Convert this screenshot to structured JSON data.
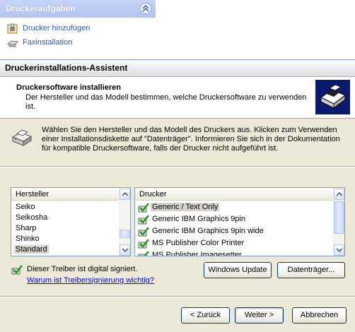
{
  "task_pane": {
    "title": "Druckeraufgaben",
    "items": [
      {
        "label": "Drucker hinzufügen",
        "icon": "add-printer-icon"
      },
      {
        "label": "Faxinstallation",
        "icon": "fax-icon"
      }
    ]
  },
  "dialog": {
    "title": "Druckerinstallations-Assistent",
    "header": {
      "title": "Druckersoftware installieren",
      "subtitle": "Der Hersteller und das Modell bestimmen, welche Druckersoftware zu verwenden ist."
    },
    "instructions": "Wählen Sie den Hersteller und das Modell des Druckers aus. Klicken zum Verwenden einer Installationsdiskette auf \"Datenträger\". Informieren Sie sich in der Dokumentation für kompatible Druckersoftware, falls der Drucker nicht aufgeführt ist.",
    "manufacturer_list": {
      "header": "Hersteller",
      "items": [
        "Seiko",
        "Seikosha",
        "Sharp",
        "Shinko",
        "Standard"
      ],
      "selected": "Standard"
    },
    "printer_list": {
      "header": "Drucker",
      "items": [
        "Generic / Text Only",
        "Generic IBM Graphics 9pin",
        "Generic IBM Graphics 9pin wide",
        "MS Publisher Color Printer",
        "MS Publisher Imagesetter"
      ],
      "selected": "Generic / Text Only"
    },
    "signature": {
      "text": "Dieser Treiber ist digital signiert.",
      "link": "Warum ist Treibersignierung wichtig?"
    },
    "buttons": {
      "windows_update": "Windows Update",
      "have_disk": "Datenträger...",
      "back": "< Zurück",
      "next": "Weiter >",
      "cancel": "Abbrechen"
    }
  },
  "colors": {
    "link": "#0000ff",
    "dialog_bg": "#ece9d8",
    "list_border": "#7f9db9",
    "selection": "#d6d3ce",
    "logo_bg": "#0a1a6e",
    "taskpane_header": "#c6d3f7"
  }
}
